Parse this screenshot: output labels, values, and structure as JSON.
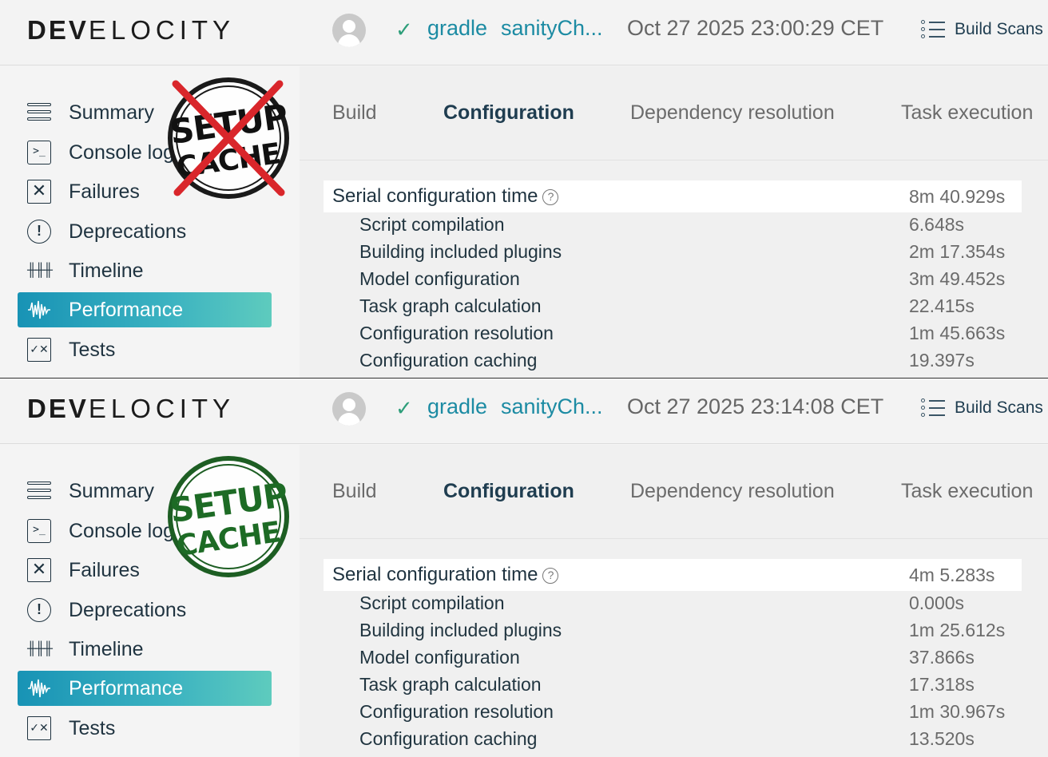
{
  "panels": [
    {
      "header": {
        "logo_bold": "DEV",
        "logo_rest": "ELOCITY",
        "status_icon": "check-icon",
        "project": "gradle",
        "task": "sanityCh...",
        "date": "Oct 27 2025 23:00:29 CET",
        "build_scans_label": "Build Scans"
      },
      "sidebar": {
        "items": [
          {
            "label": "Summary",
            "icon": "summary-icon"
          },
          {
            "label": "Console log",
            "icon": "console-icon"
          },
          {
            "label": "Failures",
            "icon": "failures-icon"
          },
          {
            "label": "Deprecations",
            "icon": "deprecations-icon"
          },
          {
            "label": "Timeline",
            "icon": "timeline-icon"
          },
          {
            "label": "Performance",
            "icon": "performance-icon",
            "active": true
          },
          {
            "label": "Tests",
            "icon": "tests-icon"
          }
        ]
      },
      "stamp": {
        "line1": "SETUP",
        "line2": "CACHE",
        "crossed_out": true,
        "color": "#111111"
      },
      "tabs": [
        "Build",
        "Configuration",
        "Dependency resolution",
        "Task execution"
      ],
      "active_tab": "Configuration",
      "metrics": {
        "header_label": "Serial configuration time",
        "header_value": "8m 40.929s",
        "rows": [
          {
            "label": "Script compilation",
            "value": "6.648s"
          },
          {
            "label": "Building included plugins",
            "value": "2m 17.354s"
          },
          {
            "label": "Model configuration",
            "value": "3m 49.452s"
          },
          {
            "label": "Task graph calculation",
            "value": "22.415s"
          },
          {
            "label": "Configuration resolution",
            "value": "1m 45.663s"
          },
          {
            "label": "Configuration caching",
            "value": "19.397s"
          }
        ]
      }
    },
    {
      "header": {
        "logo_bold": "DEV",
        "logo_rest": "ELOCITY",
        "status_icon": "check-icon",
        "project": "gradle",
        "task": "sanityCh...",
        "date": "Oct 27 2025 23:14:08 CET",
        "build_scans_label": "Build Scans"
      },
      "sidebar": {
        "items": [
          {
            "label": "Summary",
            "icon": "summary-icon"
          },
          {
            "label": "Console log",
            "icon": "console-icon"
          },
          {
            "label": "Failures",
            "icon": "failures-icon"
          },
          {
            "label": "Deprecations",
            "icon": "deprecations-icon"
          },
          {
            "label": "Timeline",
            "icon": "timeline-icon"
          },
          {
            "label": "Performance",
            "icon": "performance-icon",
            "active": true
          },
          {
            "label": "Tests",
            "icon": "tests-icon"
          }
        ]
      },
      "stamp": {
        "line1": "SETUP",
        "line2": "CACHE",
        "crossed_out": false,
        "color": "#1d6b25"
      },
      "tabs": [
        "Build",
        "Configuration",
        "Dependency resolution",
        "Task execution"
      ],
      "active_tab": "Configuration",
      "metrics": {
        "header_label": "Serial configuration time",
        "header_value": "4m 5.283s",
        "rows": [
          {
            "label": "Script compilation",
            "value": "0.000s"
          },
          {
            "label": "Building included plugins",
            "value": "1m 25.612s"
          },
          {
            "label": "Model configuration",
            "value": "37.866s"
          },
          {
            "label": "Task graph calculation",
            "value": "17.318s"
          },
          {
            "label": "Configuration resolution",
            "value": "1m 30.967s"
          },
          {
            "label": "Configuration caching",
            "value": "13.520s"
          }
        ]
      }
    }
  ],
  "colors": {
    "accent_link": "#1c8ba3",
    "active_nav_gradient_start": "#1893b5",
    "active_nav_gradient_end": "#5ecbbe",
    "check_green": "#2e9e7a",
    "stamp_cross_red": "#d9262b"
  }
}
